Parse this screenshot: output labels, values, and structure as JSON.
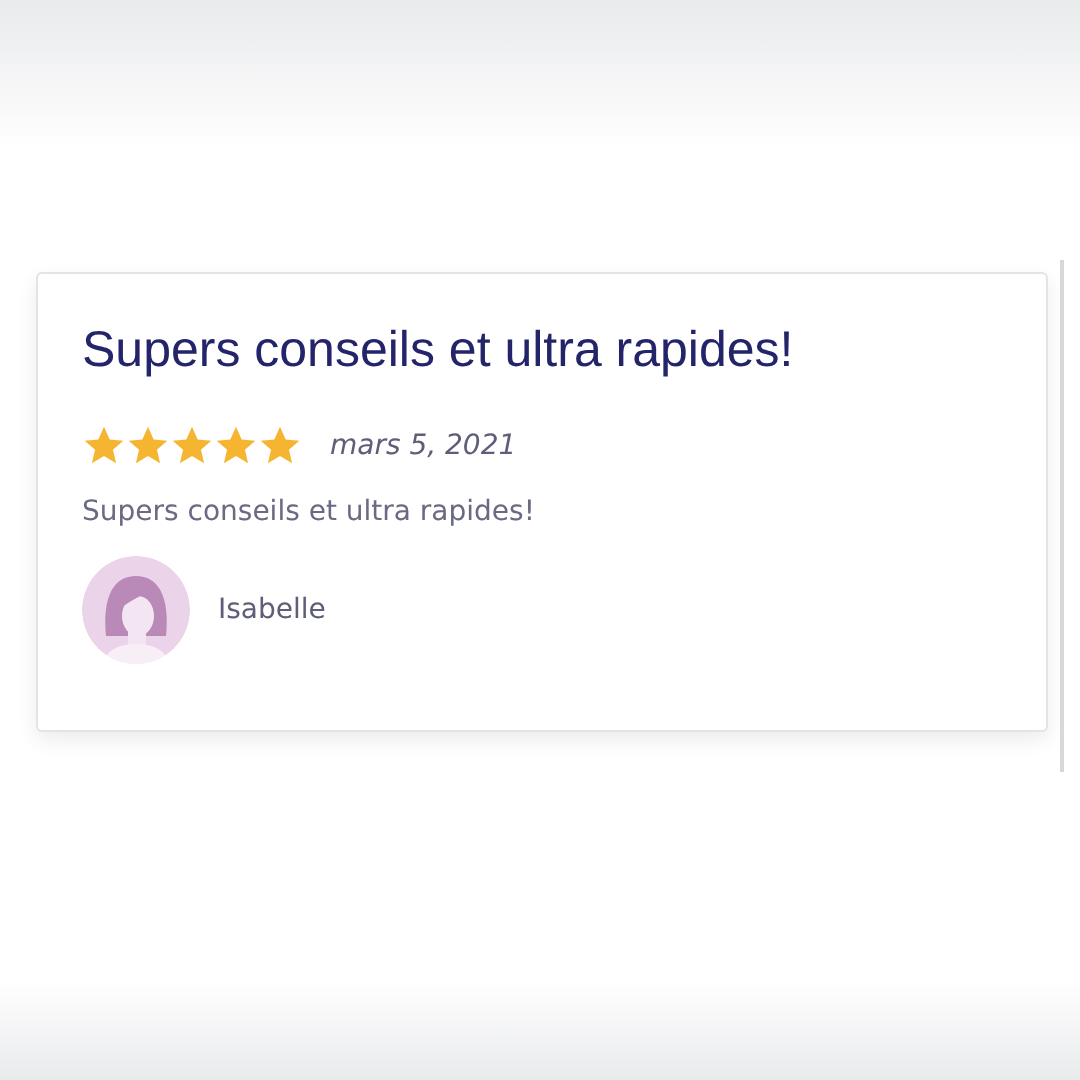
{
  "review": {
    "title": "Supers conseils et ultra rapides!",
    "stars": 5,
    "date": "mars 5, 2021",
    "text": "Supers conseils et ultra rapides!",
    "author": "Isabelle"
  }
}
